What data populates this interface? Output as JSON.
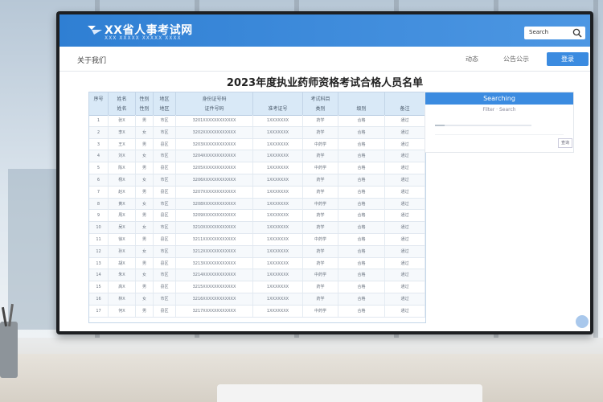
{
  "site": {
    "logo_text": "XX省人事考试网",
    "logo_subtitle": "XXX XXXXX XXXXX XXXX",
    "search_placeholder": "Search",
    "brand_color": "#3b8be0"
  },
  "nav": {
    "left_label": "关于我们",
    "items": [
      "动态",
      "公告公示"
    ],
    "button_label": "登录"
  },
  "page_title": "2023年度执业药师资格考试合格人员名单",
  "table": {
    "header_fill": "#d9e9f7",
    "columns": [
      {
        "l1": "序号",
        "l2": ""
      },
      {
        "l1": "姓名",
        "l2": "姓名"
      },
      {
        "l1": "性别",
        "l2": "性别"
      },
      {
        "l1": "地区",
        "l2": "地区"
      },
      {
        "l1": "身份证号码",
        "l2": "证件号码"
      },
      {
        "l1": "",
        "l2": "准考证号"
      },
      {
        "l1": "考试科目",
        "l2": "类别"
      },
      {
        "l1": "",
        "l2": "级别"
      },
      {
        "l1": "",
        "l2": "备注"
      }
    ],
    "rows": [
      [
        "1",
        "张X",
        "男",
        "市区",
        "3201XXXXXXXXXXXX",
        "1XXXXXXX",
        "药学",
        "合格",
        "通过"
      ],
      [
        "2",
        "李X",
        "女",
        "市区",
        "3202XXXXXXXXXXXX",
        "1XXXXXXX",
        "药学",
        "合格",
        "通过"
      ],
      [
        "3",
        "王X",
        "男",
        "县区",
        "3203XXXXXXXXXXXX",
        "1XXXXXXX",
        "中药学",
        "合格",
        "通过"
      ],
      [
        "4",
        "刘X",
        "女",
        "市区",
        "3204XXXXXXXXXXXX",
        "1XXXXXXX",
        "药学",
        "合格",
        "通过"
      ],
      [
        "5",
        "陈X",
        "男",
        "县区",
        "3205XXXXXXXXXXXX",
        "1XXXXXXX",
        "中药学",
        "合格",
        "通过"
      ],
      [
        "6",
        "杨X",
        "女",
        "市区",
        "3206XXXXXXXXXXXX",
        "1XXXXXXX",
        "药学",
        "合格",
        "通过"
      ],
      [
        "7",
        "赵X",
        "男",
        "县区",
        "3207XXXXXXXXXXXX",
        "1XXXXXXX",
        "药学",
        "合格",
        "通过"
      ],
      [
        "8",
        "黄X",
        "女",
        "市区",
        "3208XXXXXXXXXXXX",
        "1XXXXXXX",
        "中药学",
        "合格",
        "通过"
      ],
      [
        "9",
        "周X",
        "男",
        "县区",
        "3209XXXXXXXXXXXX",
        "1XXXXXXX",
        "药学",
        "合格",
        "通过"
      ],
      [
        "10",
        "吴X",
        "女",
        "市区",
        "3210XXXXXXXXXXXX",
        "1XXXXXXX",
        "药学",
        "合格",
        "通过"
      ],
      [
        "11",
        "徐X",
        "男",
        "县区",
        "3211XXXXXXXXXXXX",
        "1XXXXXXX",
        "中药学",
        "合格",
        "通过"
      ],
      [
        "12",
        "孙X",
        "女",
        "市区",
        "3212XXXXXXXXXXXX",
        "1XXXXXXX",
        "药学",
        "合格",
        "通过"
      ],
      [
        "13",
        "胡X",
        "男",
        "县区",
        "3213XXXXXXXXXXXX",
        "1XXXXXXX",
        "药学",
        "合格",
        "通过"
      ],
      [
        "14",
        "朱X",
        "女",
        "市区",
        "3214XXXXXXXXXXXX",
        "1XXXXXXX",
        "中药学",
        "合格",
        "通过"
      ],
      [
        "15",
        "高X",
        "男",
        "县区",
        "3215XXXXXXXXXXXX",
        "1XXXXXXX",
        "药学",
        "合格",
        "通过"
      ],
      [
        "16",
        "林X",
        "女",
        "市区",
        "3216XXXXXXXXXXXX",
        "1XXXXXXX",
        "药学",
        "合格",
        "通过"
      ],
      [
        "17",
        "何X",
        "男",
        "县区",
        "3217XXXXXXXXXXXX",
        "1XXXXXXX",
        "中药学",
        "合格",
        "通过"
      ]
    ]
  },
  "side_panel": {
    "title": "Searching",
    "subtitle": "Filter · Search",
    "progress": 0.1,
    "button_label": "查询"
  }
}
